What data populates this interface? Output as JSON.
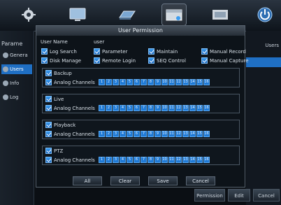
{
  "topbar": {
    "icons": [
      "gear-icon",
      "monitor-icon",
      "hdd-icon",
      "folder-icon",
      "film-icon",
      "power-icon"
    ]
  },
  "sidebar": {
    "title": "Parame",
    "items": [
      {
        "label": "Genera"
      },
      {
        "label": "Users"
      },
      {
        "label": "Info"
      },
      {
        "label": "Log"
      }
    ],
    "active_index": 1
  },
  "right": {
    "banner": "Users"
  },
  "bottom_buttons": [
    "Permission",
    "Edit",
    "Cancel"
  ],
  "dialog": {
    "title": "User Permission",
    "user_name_label": "User Name",
    "user_name_value": "user",
    "permissions": [
      {
        "label": "Log Search",
        "checked": true
      },
      {
        "label": "Parameter",
        "checked": true
      },
      {
        "label": "Maintain",
        "checked": true
      },
      {
        "label": "Manual Record",
        "checked": true
      },
      {
        "label": "Disk Manage",
        "checked": true
      },
      {
        "label": "Remote Login",
        "checked": true
      },
      {
        "label": "SEQ Control",
        "checked": true
      },
      {
        "label": "Manual Capture",
        "checked": true
      }
    ],
    "groups": [
      {
        "name": "Backup",
        "channels_label": "Analog Channels"
      },
      {
        "name": "Live",
        "channels_label": "Analog Channels"
      },
      {
        "name": "Playback",
        "channels_label": "Analog Channels"
      },
      {
        "name": "PTZ",
        "channels_label": "Analog Channels"
      }
    ],
    "channels": [
      "1",
      "2",
      "3",
      "4",
      "5",
      "6",
      "7",
      "8",
      "9",
      "10",
      "11",
      "12",
      "13",
      "14",
      "15",
      "16"
    ],
    "buttons": [
      "All",
      "Clear",
      "Save",
      "Cancel"
    ]
  },
  "colors": {
    "accent": "#1f7ad6",
    "highlight": "#1f6fc4"
  }
}
